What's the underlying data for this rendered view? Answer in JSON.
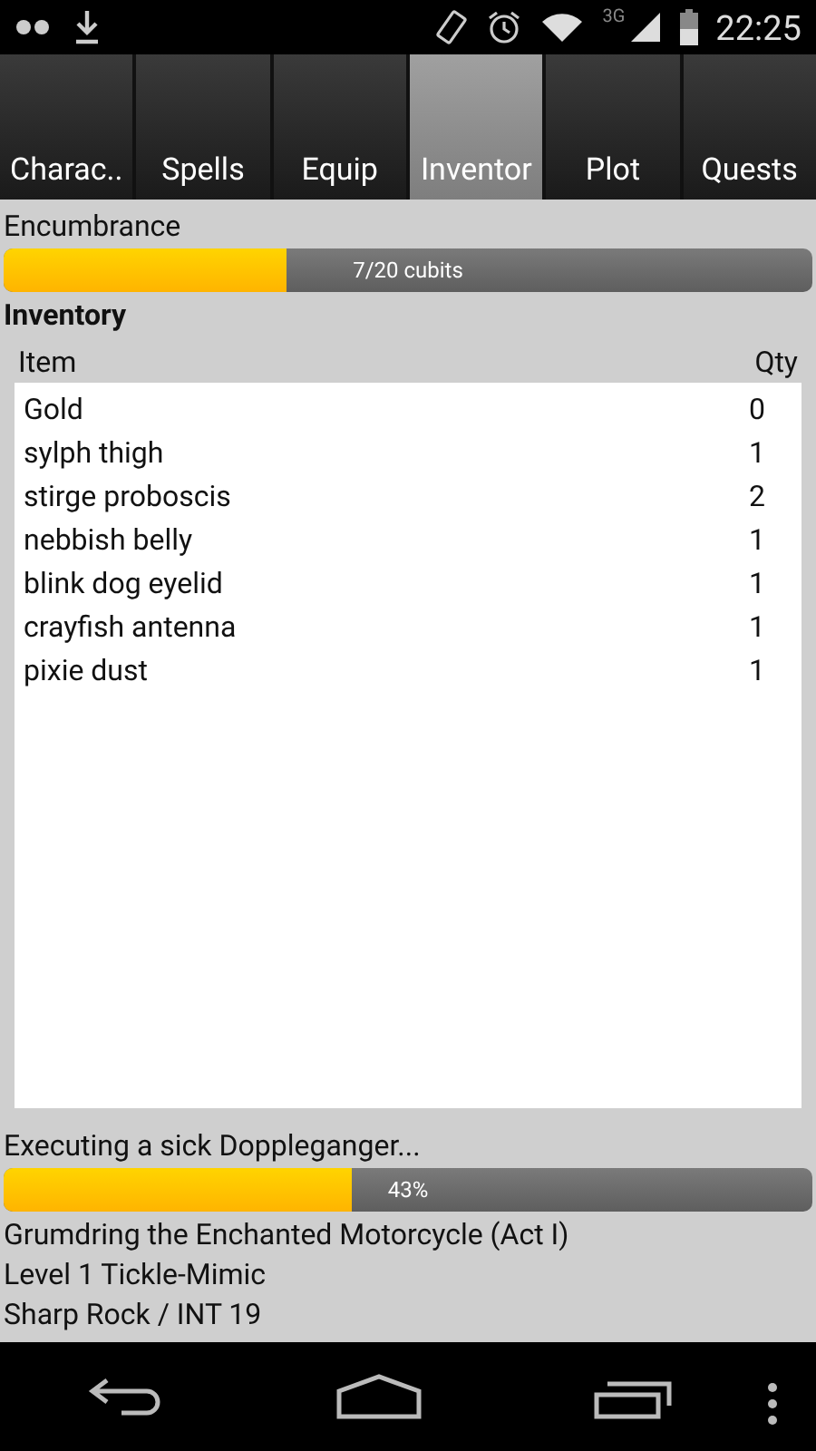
{
  "status_bar": {
    "network": "3G",
    "time": "22:25"
  },
  "tabs": [
    {
      "label": "Charac..",
      "selected": false
    },
    {
      "label": "Spells",
      "selected": false
    },
    {
      "label": "Equip",
      "selected": false
    },
    {
      "label": "Inventor",
      "selected": true
    },
    {
      "label": "Plot",
      "selected": false
    },
    {
      "label": "Quests",
      "selected": false
    }
  ],
  "encumbrance": {
    "label": "Encumbrance",
    "level": 0.35,
    "reading": "7/20 cubits"
  },
  "inventory": {
    "title": "Inventory",
    "columns": [
      "Item",
      "Qty"
    ],
    "rows": [
      [
        "Gold",
        "0"
      ],
      [
        "sylph thigh",
        "1"
      ],
      [
        "stirge proboscis",
        "2"
      ],
      [
        "nebbish belly",
        "1"
      ],
      [
        "blink dog eyelid",
        "1"
      ],
      [
        "crayfish antenna",
        "1"
      ],
      [
        "pixie dust",
        "1"
      ]
    ]
  },
  "task": {
    "label": "Executing a sick Doppleganger...",
    "level": 0.43,
    "reading": "43%"
  },
  "character_lines": [
    "Grumdring the Enchanted Motorcycle (Act I)",
    "Level 1 Tickle-Mimic",
    "Sharp Rock / INT 19"
  ]
}
